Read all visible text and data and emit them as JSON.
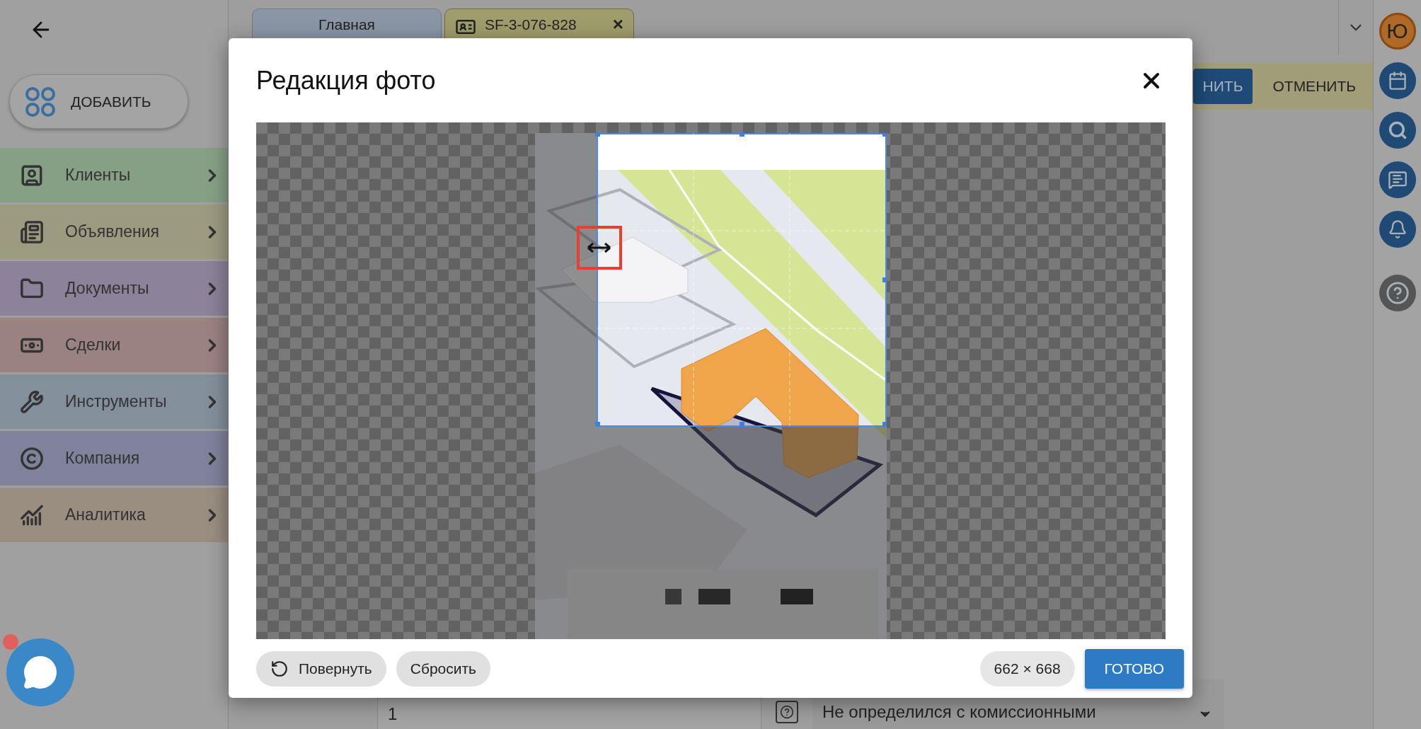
{
  "header": {
    "tabs": [
      {
        "label": "Главная",
        "selected": false
      },
      {
        "label": "SF-3-076-828",
        "selected": true,
        "close": "×"
      }
    ]
  },
  "add_button": {
    "label": "ДОБАВИТЬ"
  },
  "sidebar": {
    "items": [
      {
        "label": "Клиенты",
        "color": "#86a085"
      },
      {
        "label": "Объявления",
        "color": "#9c9b80"
      },
      {
        "label": "Документы",
        "color": "#8c8299"
      },
      {
        "label": "Сделки",
        "color": "#9a8280"
      },
      {
        "label": "Инструменты",
        "color": "#838f9a"
      },
      {
        "label": "Компания",
        "color": "#80829c"
      },
      {
        "label": "Аналитика",
        "color": "#9a8e80"
      }
    ]
  },
  "action_bar": {
    "buttons": [
      {
        "label": "НИТЬ",
        "kind": "primary"
      },
      {
        "label": "ОТМЕНИТЬ",
        "kind": "text"
      }
    ]
  },
  "user_avatar": {
    "initial": "Ю"
  },
  "form": {
    "field_value": "1",
    "select_value": "Не определился с комиссионными"
  },
  "dialog": {
    "title": "Редакция фото",
    "rotate": "Повернуть",
    "reset": "Сбросить",
    "size": "662 × 668",
    "done": "ГОТОВО"
  }
}
